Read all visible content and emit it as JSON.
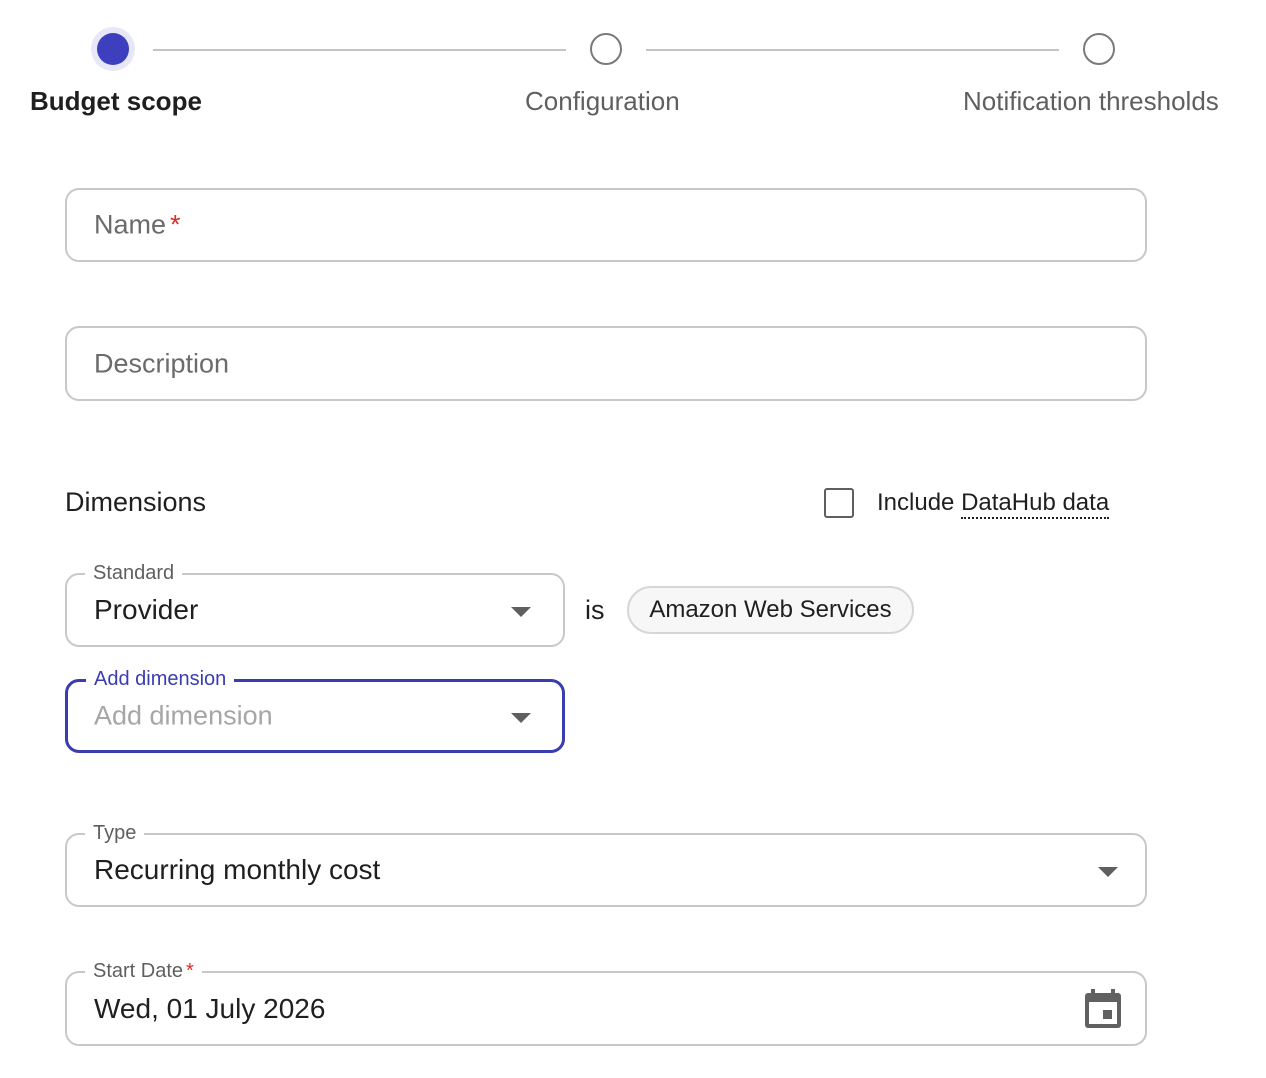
{
  "stepper": {
    "steps": [
      {
        "label": "Budget scope",
        "state": "active"
      },
      {
        "label": "Configuration",
        "state": "inactive"
      },
      {
        "label": "Notification thresholds",
        "state": "inactive"
      }
    ]
  },
  "form": {
    "name": {
      "placeholder": "Name",
      "required_mark": "*"
    },
    "description": {
      "placeholder": "Description"
    },
    "dimensions": {
      "title": "Dimensions",
      "include_datahub": {
        "label_prefix": "Include ",
        "label_link": "DataHub data",
        "checked": false
      },
      "standard": {
        "label": "Standard",
        "value": "Provider"
      },
      "operator": "is",
      "chip": "Amazon Web Services",
      "add_dimension": {
        "label": "Add dimension",
        "placeholder": "Add dimension"
      }
    },
    "type": {
      "label": "Type",
      "value": "Recurring monthly cost"
    },
    "start_date": {
      "label": "Start Date",
      "required_mark": "*",
      "value": "Wed, 01 July 2026"
    }
  },
  "icons": {
    "dropdown": "chevron-down-icon",
    "calendar": "calendar-icon"
  },
  "colors": {
    "primary": "#3d3fbf",
    "required": "#d93025",
    "border": "#c8c8c8"
  }
}
